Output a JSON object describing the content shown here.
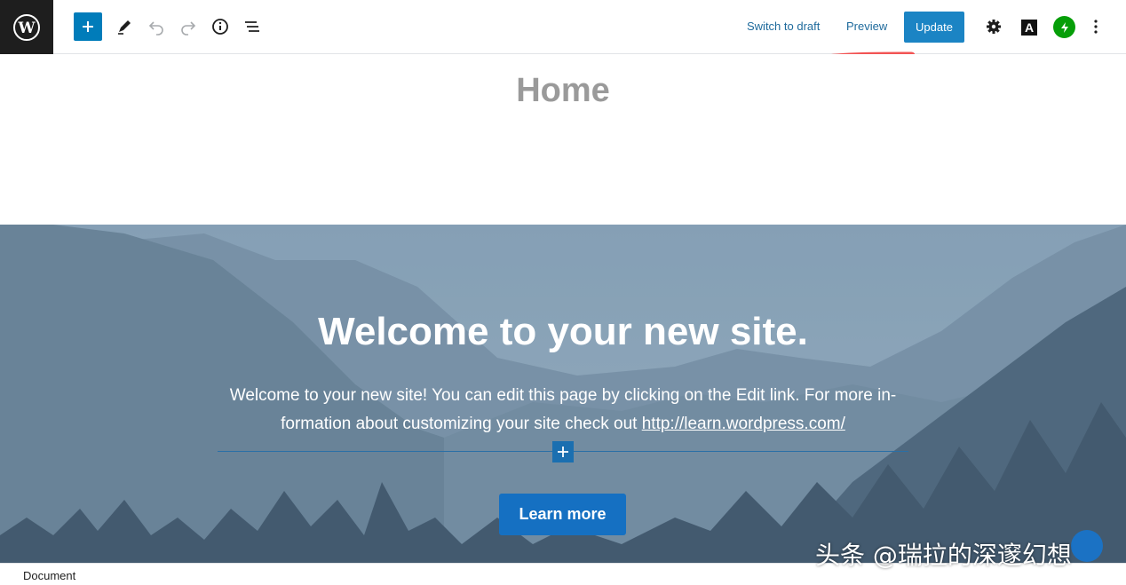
{
  "toolbar": {
    "switch_to_draft": "Switch to draft",
    "preview": "Preview",
    "update": "Update",
    "font_icon_glyph": "A",
    "icons": [
      "wordpress-logo-icon",
      "plus-icon",
      "pencil-icon",
      "undo-icon",
      "redo-icon",
      "info-icon",
      "list-view-icon",
      "gear-icon",
      "font-icon",
      "jetpack-icon",
      "more-vertical-icon"
    ]
  },
  "editor": {
    "page_title": "Home"
  },
  "cover": {
    "heading": "Welcome to your new site.",
    "text_line1": "Welcome to your new site! You can edit this page by clicking on the Edit link. For more in-",
    "text_line2": "formation about customizing your site check out ",
    "link": "http://learn.wordpress.com/",
    "button": "Learn more"
  },
  "footer": {
    "breadcrumb": "Document"
  },
  "watermark": "头条 @瑞拉的深邃幻想",
  "colors": {
    "accent": "#007cba",
    "update_button": "#1b84c4",
    "learn_button": "#1570c2",
    "jetpack": "#069e08",
    "annotation_red": "#f25454"
  }
}
